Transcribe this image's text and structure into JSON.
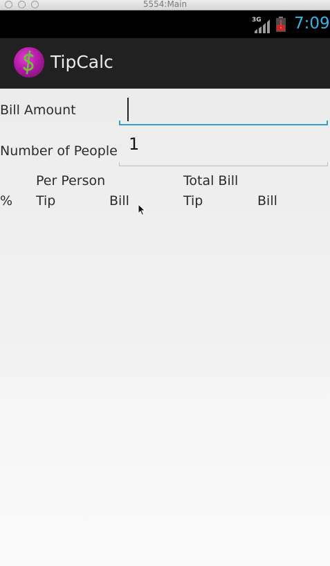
{
  "window": {
    "title": "5554:Main"
  },
  "status_bar": {
    "network": "3G",
    "time": "7:09",
    "icons": [
      "signal-icon",
      "battery-alert-icon"
    ]
  },
  "action_bar": {
    "app_icon": "dollar-icon",
    "title": "TipCalc"
  },
  "form": {
    "bill_amount": {
      "label": "Bill Amount",
      "value": ""
    },
    "people": {
      "label": "Number of People",
      "value": "1"
    }
  },
  "table": {
    "group_headers": [
      "Per Person",
      "Total Bill"
    ],
    "columns": [
      "%",
      "Tip",
      "Bill",
      "Tip",
      "Bill"
    ]
  },
  "colors": {
    "accent": "#33b5e5",
    "focus_line": "#2e9fcc",
    "action_bar": "#212121",
    "status_bar": "#000000",
    "icon_magenta": "#b31ba6",
    "icon_dollar": "#6fbf3e"
  }
}
